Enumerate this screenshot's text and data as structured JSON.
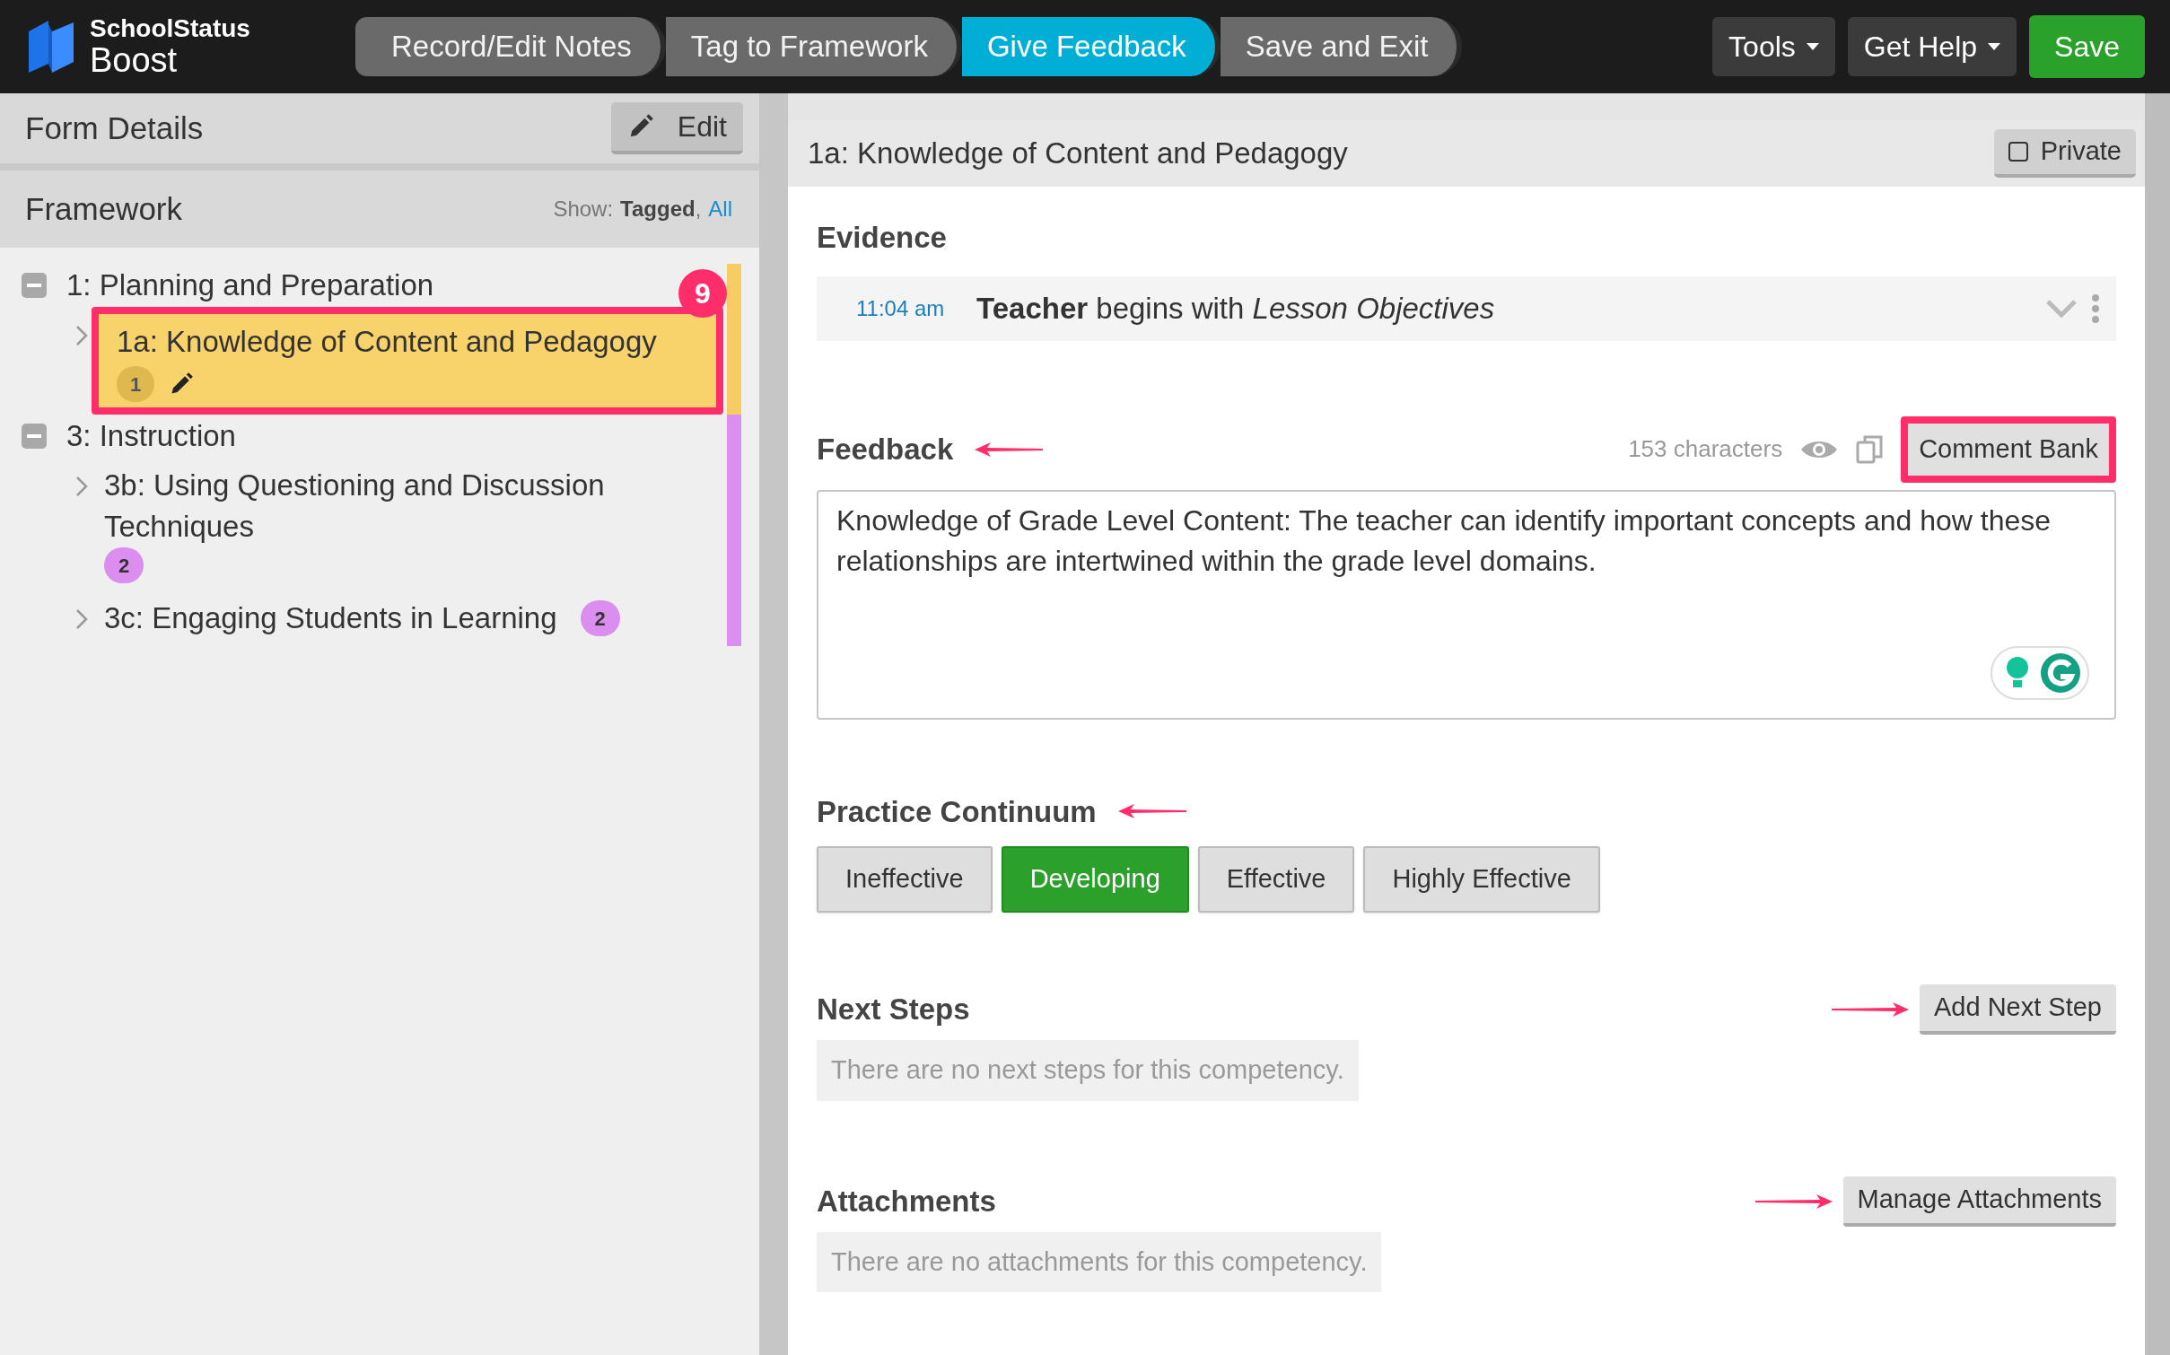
{
  "app": {
    "brand": "SchoolStatus",
    "product": "Boost"
  },
  "steps": [
    {
      "label": "Record/Edit Notes",
      "selected": false
    },
    {
      "label": "Tag to Framework",
      "selected": false
    },
    {
      "label": "Give Feedback",
      "selected": true
    },
    {
      "label": "Save and Exit",
      "selected": false
    }
  ],
  "toolbar": [
    {
      "label": "Tools",
      "kind": "menu"
    },
    {
      "label": "Get Help",
      "kind": "menu"
    },
    {
      "label": "Save",
      "kind": "primary"
    }
  ],
  "sidebar": {
    "form_details": {
      "title": "Form Details",
      "edit": "Edit"
    },
    "framework": {
      "title": "Framework",
      "show_label": "Show:",
      "show_options": [
        {
          "label": "Tagged",
          "selected": true,
          "separator": ","
        },
        {
          "label": "All",
          "selected": false
        }
      ]
    },
    "tree": [
      {
        "label": "1: Planning and Preparation",
        "expanded": true,
        "color": "#f7cd63",
        "children": [
          {
            "label": "1a: Knowledge of Content and Pedagogy",
            "count": "1",
            "selected": true,
            "editing": true,
            "callout": "9"
          }
        ]
      },
      {
        "label": "3: Instruction",
        "expanded": true,
        "color": "#dc8ef0",
        "children": [
          {
            "label": "3b: Using Questioning and Discussion Techniques",
            "count": "2",
            "selected": false,
            "editing": false
          },
          {
            "label": "3c: Engaging Students in Learning",
            "count": "2",
            "selected": false,
            "editing": false
          }
        ]
      }
    ]
  },
  "card": {
    "title": "1a: Knowledge of Content and Pedagogy",
    "private": {
      "label": "Private",
      "checked": false
    },
    "evidence": {
      "title": "Evidence",
      "pointed": false,
      "items": [
        {
          "time": "11:04 am",
          "text": "**Teacher** begins with *Lesson Objectives*"
        }
      ]
    },
    "feedback": {
      "title": "Feedback",
      "pointed": true,
      "char_count": "153 characters",
      "comment_bank": {
        "label": "Comment Bank",
        "highlighted": true
      },
      "value": "Knowledge of Grade Level Content: The teacher can identify important concepts and how these relationships are intertwined within the grade level domains."
    },
    "practice": {
      "title": "Practice Continuum",
      "pointed": true,
      "levels": [
        {
          "label": "Ineffective",
          "selected": false
        },
        {
          "label": "Developing",
          "selected": true
        },
        {
          "label": "Effective",
          "selected": false
        },
        {
          "label": "Highly Effective",
          "selected": false
        }
      ]
    },
    "next_steps": {
      "title": "Next Steps",
      "button": "Add Next Step",
      "pointed": true,
      "empty": "There are no next steps for this competency."
    },
    "attachments": {
      "title": "Attachments",
      "button": "Manage Attachments",
      "pointed": true,
      "empty": "There are no attachments for this competency."
    }
  }
}
